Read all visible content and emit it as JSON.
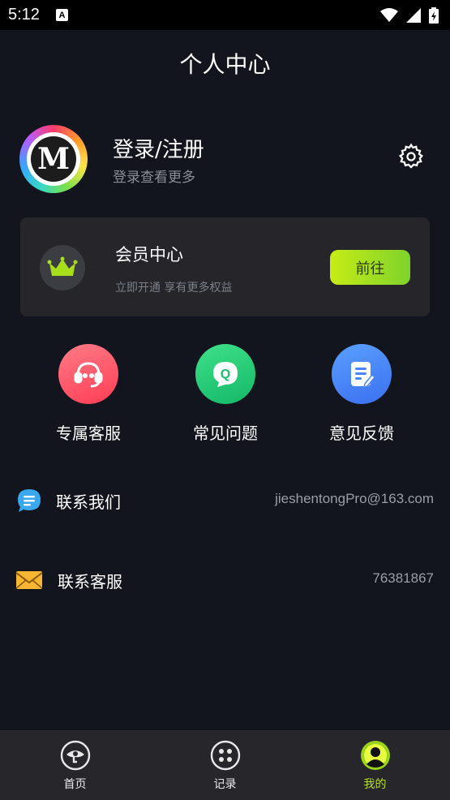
{
  "status_bar": {
    "time": "5:12",
    "notification": "A"
  },
  "header": {
    "title": "个人中心"
  },
  "profile": {
    "avatar_letter": "M",
    "login_label": "登录/注册",
    "subtitle": "登录查看更多"
  },
  "vip": {
    "title": "会员中心",
    "subtitle": "立即开通  享有更多权益",
    "button_label": "前往"
  },
  "shortcuts": [
    {
      "label": "专属客服",
      "icon": "headset-icon",
      "color": "#ff5b6b"
    },
    {
      "label": "常见问题",
      "icon": "faq-icon",
      "color": "#2fd27a"
    },
    {
      "label": "意见反馈",
      "icon": "feedback-icon",
      "color": "#4d8dff"
    }
  ],
  "contact_rows": [
    {
      "label": "联系我们",
      "value": "jieshentongPro@163.com",
      "icon": "chat-icon"
    },
    {
      "label": "联系客服",
      "value": "76381867",
      "icon": "mail-icon"
    }
  ],
  "tabbar": {
    "tabs": [
      {
        "label": "首页",
        "icon": "home-eye-icon"
      },
      {
        "label": "记录",
        "icon": "grid-icon"
      },
      {
        "label": "我的",
        "icon": "person-icon",
        "active": true
      }
    ]
  },
  "colors": {
    "accent": "#b4e020",
    "background": "#13151e",
    "card": "#25252a"
  }
}
